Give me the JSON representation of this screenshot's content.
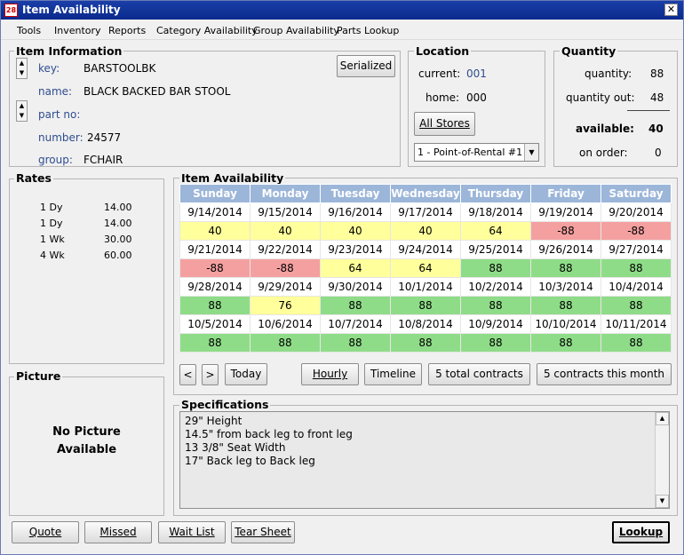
{
  "window": {
    "title": "Item Availability",
    "icon": "calendar-icon",
    "close": "✕",
    "app_icon_text": "28"
  },
  "menu": [
    "Tools",
    "Inventory",
    "Reports",
    "Category Availability",
    "Group Availability",
    "Parts Lookup"
  ],
  "item_info": {
    "title": "Item Information",
    "key_label": "key:",
    "key": "BARSTOOLBK",
    "name_label": "name:",
    "name": "BLACK BACKED BAR STOOL",
    "part_label": "part no:",
    "part": "",
    "number_label": "number:",
    "number": "24577",
    "group_label": "group:",
    "group": "FCHAIR",
    "serialized": "Serialized"
  },
  "location": {
    "title": "Location",
    "current_label": "current:",
    "current": "001",
    "home_label": "home:",
    "home": "000",
    "all_stores": "All Stores",
    "store_select": "1 - Point-of-Rental #1"
  },
  "quantity": {
    "title": "Quantity",
    "quantity_label": "quantity:",
    "quantity": "88",
    "out_label": "quantity out:",
    "out": "48",
    "available_label": "available:",
    "available": "40",
    "onorder_label": "on order:",
    "onorder": "0"
  },
  "rates": {
    "title": "Rates",
    "rows": [
      [
        "1 Dy",
        "14.00"
      ],
      [
        "1 Dy",
        "14.00"
      ],
      [
        "1 Wk",
        "30.00"
      ],
      [
        "4 Wk",
        "60.00"
      ]
    ]
  },
  "picture": {
    "title": "Picture",
    "text1": "No Picture",
    "text2": "Available"
  },
  "availability": {
    "title": "Item Availability",
    "days": [
      "Sunday",
      "Monday",
      "Tuesday",
      "Wednesday",
      "Thursday",
      "Friday",
      "Saturday"
    ],
    "weeks": [
      {
        "dates": [
          "9/14/2014",
          "9/15/2014",
          "9/16/2014",
          "9/17/2014",
          "9/18/2014",
          "9/19/2014",
          "9/20/2014"
        ],
        "vals": [
          "40",
          "40",
          "40",
          "40",
          "64",
          "-88",
          "-88"
        ],
        "colors": [
          "y",
          "y",
          "y",
          "y",
          "y",
          "r",
          "r"
        ]
      },
      {
        "dates": [
          "9/21/2014",
          "9/22/2014",
          "9/23/2014",
          "9/24/2014",
          "9/25/2014",
          "9/26/2014",
          "9/27/2014"
        ],
        "vals": [
          "-88",
          "-88",
          "64",
          "64",
          "88",
          "88",
          "88"
        ],
        "colors": [
          "r",
          "r",
          "y",
          "y",
          "g",
          "g",
          "g"
        ]
      },
      {
        "dates": [
          "9/28/2014",
          "9/29/2014",
          "9/30/2014",
          "10/1/2014",
          "10/2/2014",
          "10/3/2014",
          "10/4/2014"
        ],
        "vals": [
          "88",
          "76",
          "88",
          "88",
          "88",
          "88",
          "88"
        ],
        "colors": [
          "g",
          "y",
          "g",
          "g",
          "g",
          "g",
          "g"
        ]
      },
      {
        "dates": [
          "10/5/2014",
          "10/6/2014",
          "10/7/2014",
          "10/8/2014",
          "10/9/2014",
          "10/10/2014",
          "10/11/2014"
        ],
        "vals": [
          "88",
          "88",
          "88",
          "88",
          "88",
          "88",
          "88"
        ],
        "colors": [
          "g",
          "g",
          "g",
          "g",
          "g",
          "g",
          "g"
        ]
      }
    ],
    "prev": "<",
    "next": ">",
    "today": "Today",
    "hourly": "Hourly",
    "timeline": "Timeline",
    "total_contracts": "5 total contracts",
    "month_contracts": "5 contracts this month"
  },
  "specs": {
    "title": "Specifications",
    "lines": [
      "29\" Height",
      "14.5\" from back leg to front leg",
      "13 3/8\" Seat Width",
      "17\" Back leg to Back leg"
    ]
  },
  "footer": {
    "quote": "Quote",
    "missed": "Missed",
    "waitlist": "Wait List",
    "tearsheet": "Tear Sheet",
    "lookup": "Lookup"
  },
  "colors": {
    "y": "#ffff9b",
    "r": "#f4a0a0",
    "g": "#8fdc88",
    "header": "#9cb6d9"
  }
}
